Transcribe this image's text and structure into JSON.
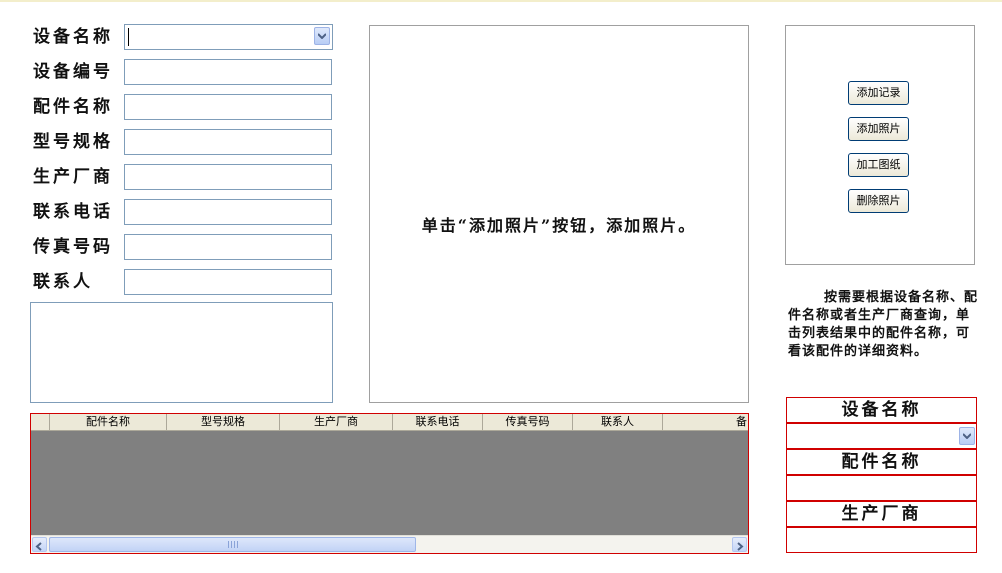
{
  "form": {
    "fields": [
      {
        "label": "设备名称",
        "value": ""
      },
      {
        "label": "设备编号",
        "value": ""
      },
      {
        "label": "配件名称",
        "value": ""
      },
      {
        "label": "型号规格",
        "value": ""
      },
      {
        "label": "生产厂商",
        "value": ""
      },
      {
        "label": "联系电话",
        "value": ""
      },
      {
        "label": "传真号码",
        "value": ""
      },
      {
        "label": "联系人",
        "value": ""
      }
    ],
    "memo": ""
  },
  "photo": {
    "hint": "单击“添加照片”按钮，添加照片。"
  },
  "buttons": {
    "add_record": "添加记录",
    "add_photo": "添加照片",
    "drawing": "加工图纸",
    "delete_photo": "删除照片"
  },
  "help_text": "按需要根据设备名称、配件名称或者生产厂商查询，单击列表结果中的配件名称，可看该配件的详细资料。",
  "grid": {
    "columns": [
      "配件名称",
      "型号规格",
      "生产厂商",
      "联系电话",
      "传真号码",
      "联系人",
      "备"
    ]
  },
  "search": {
    "device_name_label": "设备名称",
    "device_name_value": "",
    "part_name_label": "配件名称",
    "part_name_value": "",
    "manufacturer_label": "生产厂商",
    "manufacturer_value": ""
  },
  "icons": {
    "dropdown": "chevron-down-icon",
    "scroll_left": "arrow-left-icon",
    "scroll_right": "arrow-right-icon"
  },
  "colors": {
    "grid_border": "#d00000",
    "grid_background": "#808080",
    "field_border": "#7f9db9"
  }
}
